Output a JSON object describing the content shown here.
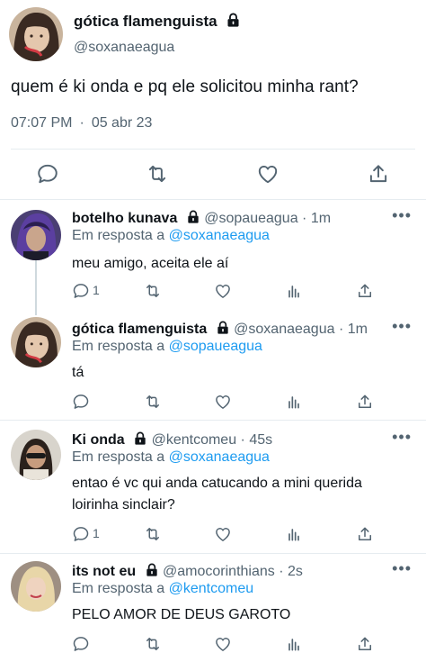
{
  "main_tweet": {
    "name": "gótica flamenguista",
    "handle": "@soxanaeagua",
    "text": "quem é ki onda e pq ele solicitou minha rant?",
    "time": "07:07 PM",
    "date": "05 abr 23"
  },
  "replies": [
    {
      "name": "botelho kunava",
      "handle": "@sopaueagua",
      "time": "1m",
      "in_reply_label": "Em resposta a",
      "in_reply_to": "@soxanaeagua",
      "text": "meu amigo, aceita ele aí",
      "reply_count": "1"
    },
    {
      "name": "gótica flamenguista",
      "handle": "@soxanaeagua",
      "time": "1m",
      "in_reply_label": "Em resposta a",
      "in_reply_to": "@sopaueagua",
      "text": "tá",
      "reply_count": ""
    },
    {
      "name": "Ki onda",
      "handle": "@kentcomeu",
      "time": "45s",
      "in_reply_label": "Em resposta a",
      "in_reply_to": "@soxanaeagua",
      "text_line1": "entao é vc qui anda catucando a mini querida",
      "text_line2": "loirinha sinclair?",
      "reply_count": "1"
    },
    {
      "name": "its not eu",
      "handle": "@amocorinthians",
      "time": "2s",
      "in_reply_label": "Em resposta a",
      "in_reply_to": "@kentcomeu",
      "text": "PELO AMOR DE DEUS GAROTO",
      "reply_count": ""
    }
  ],
  "separator": "·",
  "more_label": "•••",
  "icons": {
    "lock": "lock-icon",
    "reply": "reply-icon",
    "retweet": "retweet-icon",
    "like": "heart-icon",
    "views": "views-icon",
    "share": "share-icon"
  },
  "colors": {
    "accent": "#1d9bf0",
    "secondary_text": "#536471",
    "thread_line": "#cfd9de"
  }
}
